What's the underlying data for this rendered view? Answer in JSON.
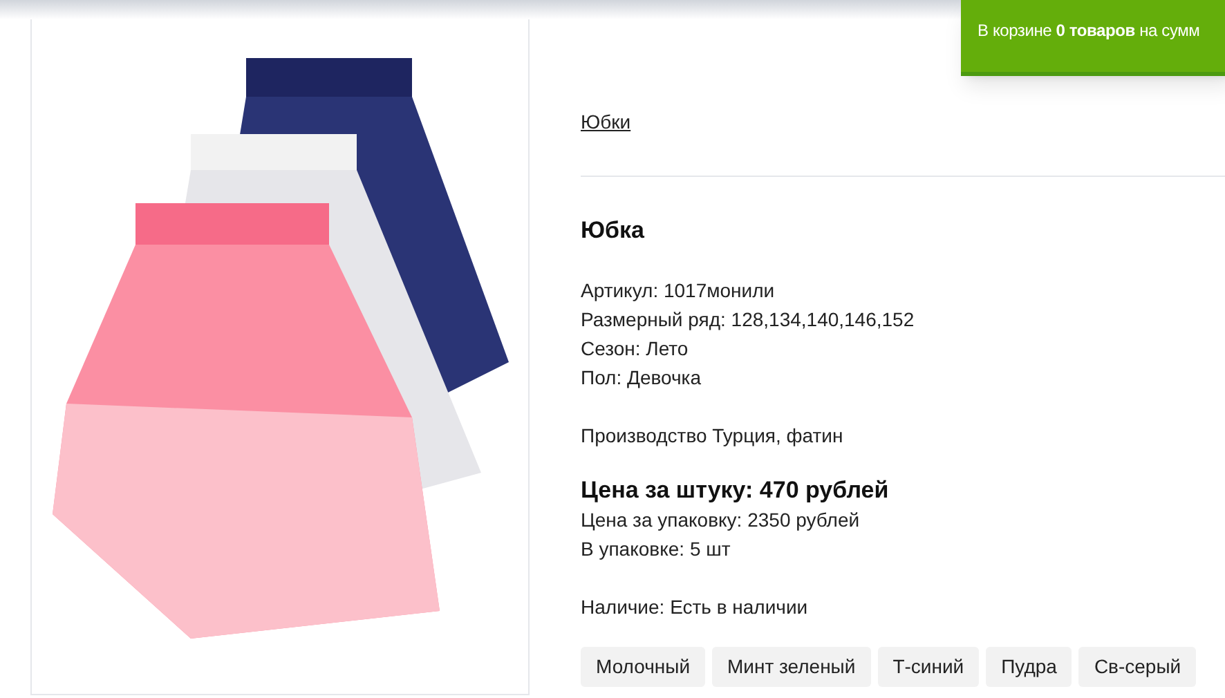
{
  "cart_banner": {
    "text": "В корзине **0 товаров** на сумм"
  },
  "breadcrumb": "Юбки",
  "product": {
    "title": "Юбка",
    "specs": [
      "Артикул: 1017монили",
      "Размерный ряд: 128,134,140,146,152",
      "Сезон: Лето",
      "Пол: Девочка"
    ],
    "production": "Производство Турция, фатин",
    "price": "Цена за штуку: 470 рублей",
    "pack_price": "Цена за упаковку: 2350 рублей",
    "pack_size": "В упаковке: 5 шт",
    "availability": "Наличие: Есть в наличии",
    "colors": [
      "Молочный",
      "Минт зеленый",
      "Т-синий",
      "Пудра",
      "Св-серый"
    ]
  }
}
